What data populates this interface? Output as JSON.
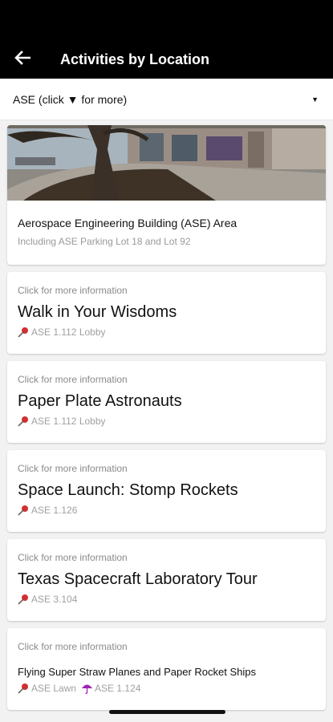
{
  "app_bar": {
    "title": "Activities by Location"
  },
  "location_select": {
    "value": "ASE (click ▼ for more)"
  },
  "hero": {
    "title": "Aerospace Engineering Building (ASE) Area",
    "subtitle": "Including ASE Parking Lot 18 and Lot 92"
  },
  "activities": [
    {
      "hint": "Click for more information",
      "title": "Walk in Your Wisdoms",
      "location": "ASE 1.112 Lobby"
    },
    {
      "hint": "Click for more information",
      "title": "Paper Plate Astronauts",
      "location": "ASE 1.112 Lobby"
    },
    {
      "hint": "Click for more information",
      "title": "Space Launch: Stomp Rockets",
      "location": "ASE 1.126"
    },
    {
      "hint": "Click for more information",
      "title": "Texas Spacecraft Laboratory Tour",
      "location": "ASE 3.104"
    },
    {
      "hint": "Click for more information",
      "title": "Flying Super Straw Planes and Paper Rocket Ships",
      "location": "ASE Lawn",
      "rain_location": "ASE 1.124"
    }
  ],
  "icons": {
    "back": "arrow-back-icon",
    "caret": "caret-down-icon",
    "pin": "pushpin-icon",
    "rain": "umbrella-icon"
  },
  "colors": {
    "app_bar": "#000000",
    "pin": "#d32f2f",
    "umbrella": "#9c27b0"
  }
}
